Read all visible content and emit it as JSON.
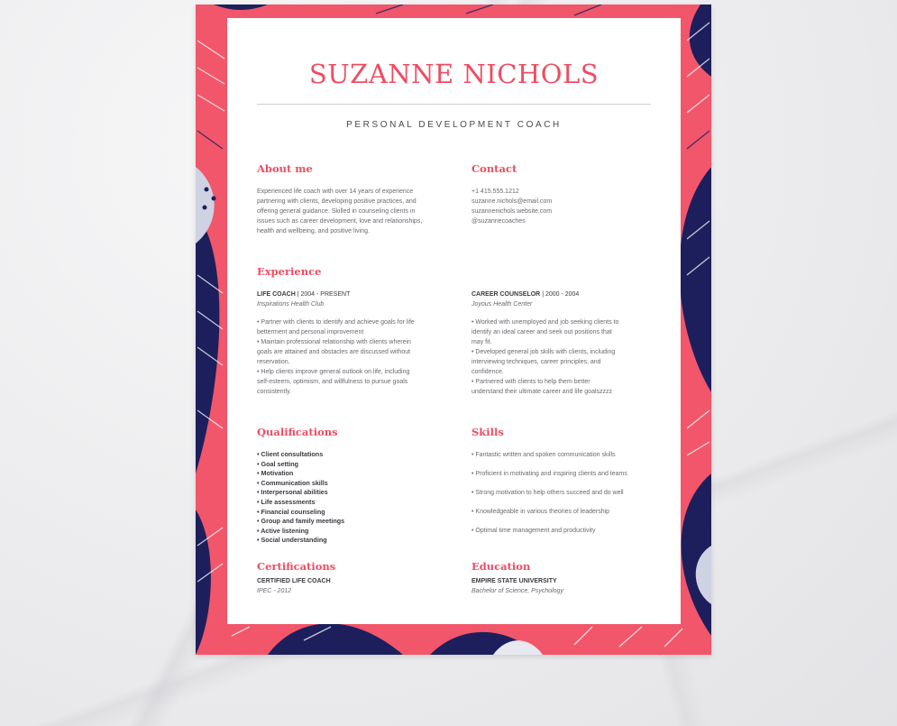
{
  "colors": {
    "accent": "#ee4d62",
    "leaf_pink": "#f1566a",
    "leaf_navy": "#1d1f5c",
    "paper": "#ffffff"
  },
  "resume": {
    "name": "SUZANNE NICHOLS",
    "title": "PERSONAL DEVELOPMENT COACH",
    "about": {
      "heading": "About me",
      "lines": [
        "Experienced life coach with over 14 years of experience",
        "partnering with clients, developing positive practices, and",
        "offering general guidance. Skilled in counseling clients in",
        "issues such as career development, love and relationships,",
        "health and wellbeing, and positive living."
      ]
    },
    "contact": {
      "heading": "Contact",
      "phone": "+1 415.555.1212",
      "email": "suzanne.nichols@email.com",
      "website": "suzannenichols.website.com",
      "handle": "@suzannecoaches"
    },
    "experience": {
      "heading": "Experience",
      "jobs": [
        {
          "title": "LIFE COACH",
          "dates": "| 2004 - PRESENT",
          "org": "Inspirations Health Club",
          "lines": [
            "• Partner with clients to identify and achieve goals for life",
            "betterment and personal improvement",
            "• Maintain professional relationship with clients wherein",
            "goals are attained and obstacles are discussed without",
            "reservation.",
            "• Help clients improve general outlook on life, including",
            "self-esteem, optimism, and willfulness to pursue goals",
            "consistently."
          ]
        },
        {
          "title": "CAREER COUNSELOR",
          "dates": "| 2000 - 2004",
          "org": "Joyous Health Center",
          "lines": [
            "• Worked with unemployed and job seeking clients to",
            "identify an ideal career and seek out positions that",
            "may fit.",
            "• Developed general job skills with clients, including",
            "interviewing techniques, career principles, and",
            "confidence.",
            "• Partnered with clients to help them better",
            "understand their ultimate career and life goalszzzz"
          ]
        }
      ]
    },
    "qualifications": {
      "heading": "Qualifications",
      "items": [
        "• Client consultations",
        "• Goal setting",
        "• Motivation",
        "• Communication skills",
        "• Interpersonal abilities",
        "• Life assessments",
        "• Financial counseling",
        "• Group and family meetings",
        "• Active listening",
        "• Social understanding"
      ]
    },
    "skills": {
      "heading": "Skills",
      "items": [
        "• Fantastic written and spoken communication skills",
        "• Proficient in motivating and inspiring clients and teams",
        "• Strong motivation to help others succeed and do well",
        "• Knowledgeable in various theories of leadership",
        "• Optimal time management and productivity"
      ]
    },
    "certifications": {
      "heading": "Certifications",
      "name": "CERTIFIED LIFE COACH",
      "detail": "IPEC - 2012"
    },
    "education": {
      "heading": "Education",
      "school": "EMPIRE STATE UNIVERSITY",
      "degree": "Bachelor of Science, Psychology"
    }
  }
}
